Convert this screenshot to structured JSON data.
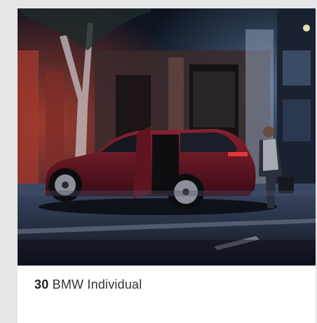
{
  "card": {
    "image_alt": "BMW X5 parked at night in front of a building, person at the open rear door",
    "number": "30",
    "title": "BMW Individual"
  }
}
